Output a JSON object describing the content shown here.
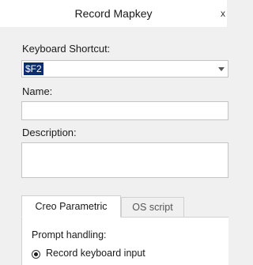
{
  "dialog": {
    "title": "Record Mapkey",
    "close_glyph": "x"
  },
  "keyboard_shortcut": {
    "label": "Keyboard Shortcut:",
    "value": "$F2"
  },
  "name": {
    "label": "Name:",
    "value": ""
  },
  "description": {
    "label": "Description:",
    "value": ""
  },
  "tabs": [
    {
      "label": "Creo Parametric",
      "active": true
    },
    {
      "label": "OS script",
      "active": false
    }
  ],
  "prompt_handling": {
    "label": "Prompt handling:",
    "option": "Record keyboard input",
    "selected": true
  }
}
